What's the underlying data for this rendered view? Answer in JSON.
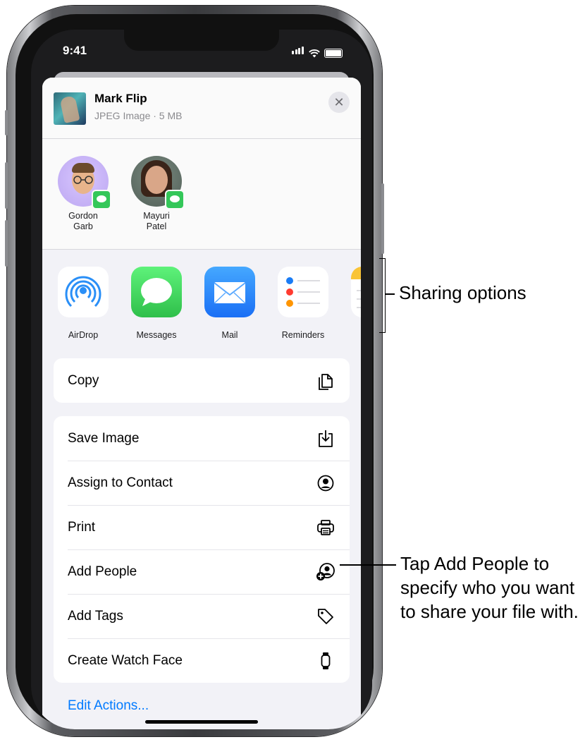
{
  "status_bar": {
    "time": "9:41"
  },
  "sheet": {
    "file": {
      "title": "Mark Flip",
      "subtitle": "JPEG Image · 5 MB"
    },
    "close_label": "✕",
    "people": [
      {
        "name_line1": "Gordon",
        "name_line2": "Garb"
      },
      {
        "name_line1": "Mayuri",
        "name_line2": "Patel"
      }
    ],
    "apps": [
      {
        "label": "AirDrop",
        "icon": "airdrop-icon"
      },
      {
        "label": "Messages",
        "icon": "messages-icon"
      },
      {
        "label": "Mail",
        "icon": "mail-icon"
      },
      {
        "label": "Reminders",
        "icon": "reminders-icon"
      },
      {
        "label": "",
        "icon": "notes-icon"
      }
    ],
    "actions_group1": [
      {
        "label": "Copy",
        "icon": "copy-icon"
      }
    ],
    "actions_group2": [
      {
        "label": "Save Image",
        "icon": "save-image-icon"
      },
      {
        "label": "Assign to Contact",
        "icon": "contact-icon"
      },
      {
        "label": "Print",
        "icon": "print-icon"
      },
      {
        "label": "Add People",
        "icon": "add-people-icon"
      },
      {
        "label": "Add Tags",
        "icon": "tag-icon"
      },
      {
        "label": "Create Watch Face",
        "icon": "watch-icon"
      }
    ],
    "edit_actions": "Edit Actions..."
  },
  "callouts": {
    "sharing_options": "Sharing options",
    "add_people": "Tap Add People to specify who you want to share your file with."
  },
  "colors": {
    "link": "#007aff",
    "sheet_bg": "#f2f2f7",
    "messages_green": "#34c759",
    "mail_blue": "#1a6ff5"
  }
}
